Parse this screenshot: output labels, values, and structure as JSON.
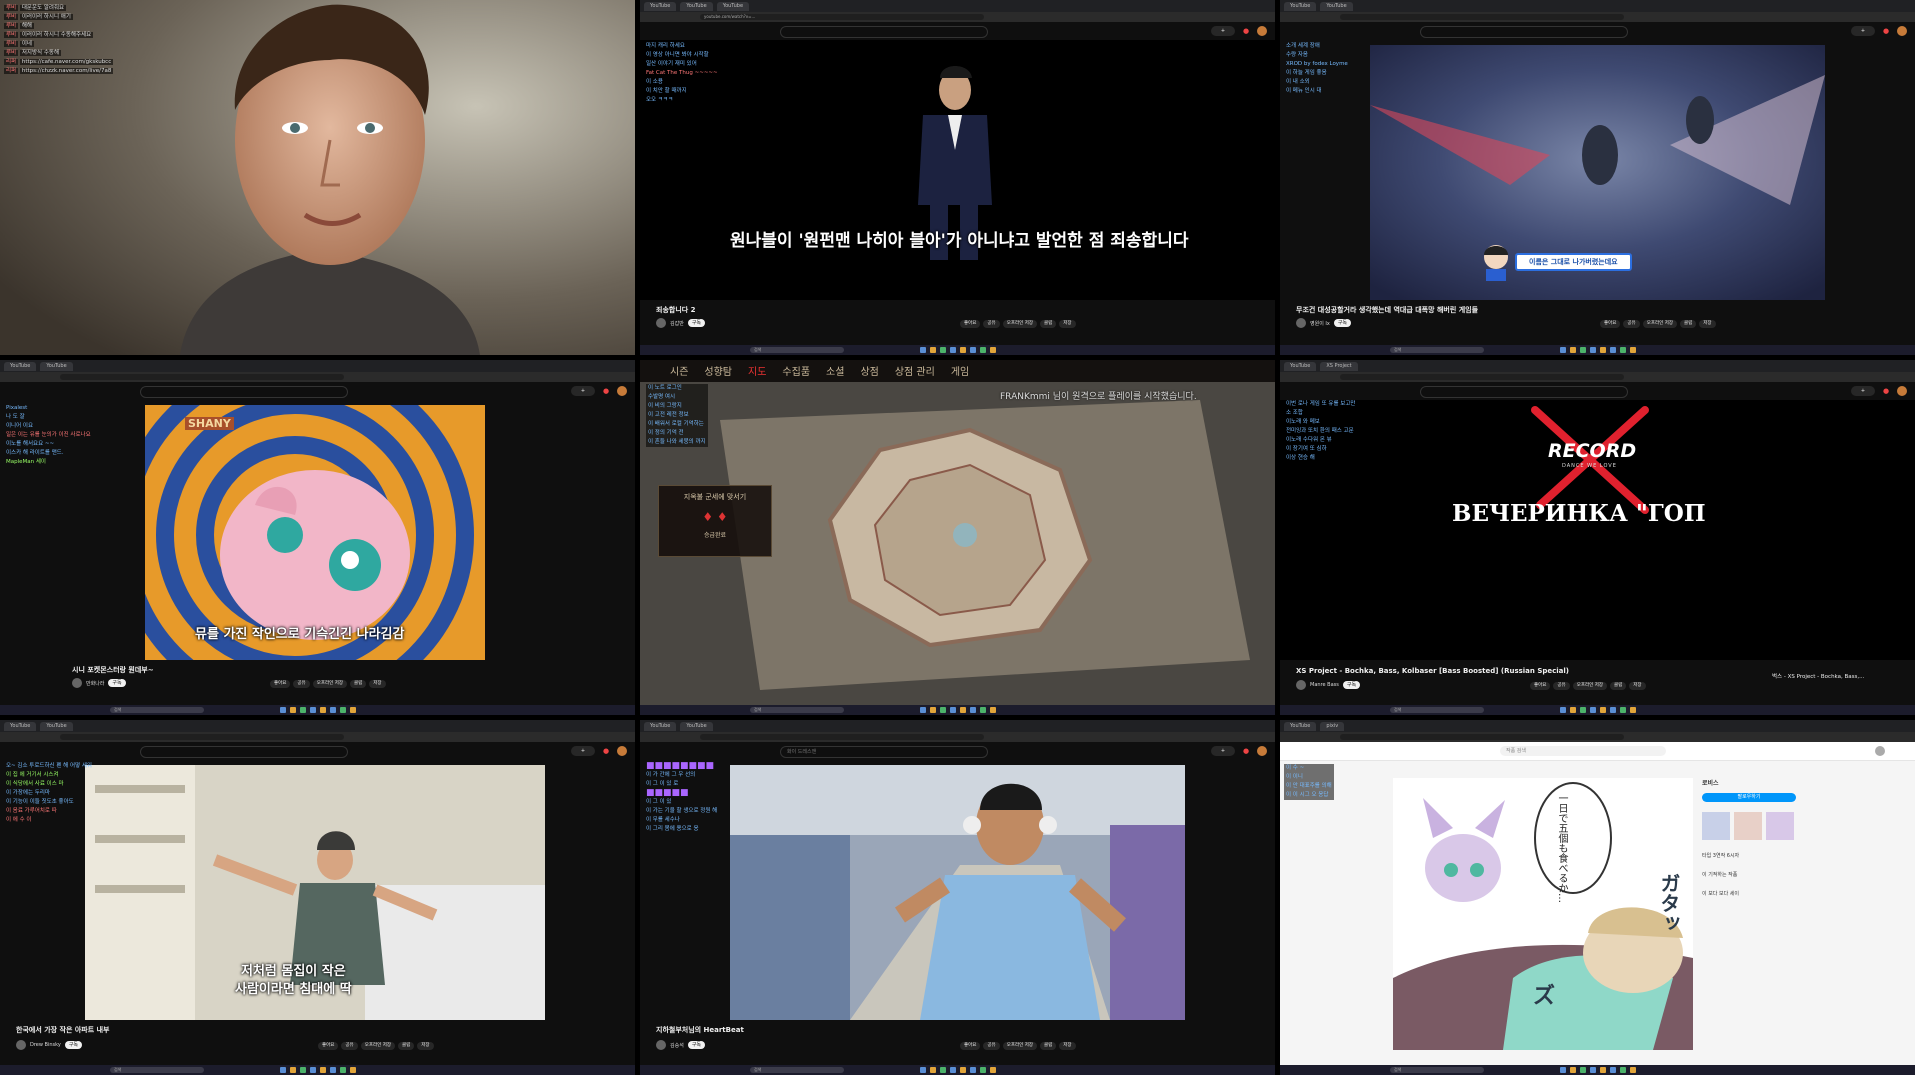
{
  "grid": {
    "tiles": 9
  },
  "tile1": {
    "chat": [
      {
        "name": "루비",
        "text": "대문운도 알려줘요"
      },
      {
        "name": "루비",
        "text": "이러이러 하시니 애기"
      },
      {
        "name": "루비",
        "text": "해해"
      },
      {
        "name": "루비",
        "text": "이러이러 하시니 수동해주세요"
      },
      {
        "name": "루비",
        "text": "이네"
      },
      {
        "name": "루비",
        "text": "저지방식 수동해"
      },
      {
        "name": "리퍼",
        "text": "https://cafe.naver.com/gkskubcc"
      },
      {
        "name": "리퍼",
        "text": "https://chzzk.naver.com/live/7a8"
      }
    ]
  },
  "tile2": {
    "tabs": [
      "YouTube",
      "YouTube",
      "YouTube"
    ],
    "url": "youtube.com/watch?v=...",
    "chat": [
      {
        "name": "",
        "text": "마지 캐리 하세요"
      },
      {
        "name": "",
        "text": "이 영상 아니면 봐야 시작할"
      },
      {
        "name": "",
        "text": "일산 이야기 재미 있어"
      },
      {
        "name": "",
        "text": "Fat Cat The Thug ~~~~~"
      },
      {
        "name": "",
        "text": "이 소용"
      },
      {
        "name": "",
        "text": "이 치안 할 때까지"
      },
      {
        "name": "",
        "text": "오오 ㅋㅋㅋ"
      }
    ],
    "subtitle": "원나블이 '원펀맨 나히아 블아'가 아니냐고 발언한 점 죄송합니다",
    "title": "죄송합니다 2",
    "channel": "김갑반",
    "subscribe": "구독",
    "actions": [
      "좋아요",
      "공유",
      "오프라인 저장",
      "클립",
      "저장"
    ]
  },
  "tile3": {
    "chat": [
      {
        "name": "",
        "text": "소개 세계 장애"
      },
      {
        "name": "",
        "text": "수량 자음"
      },
      {
        "name": "",
        "text": "XROD by fodex Loyme"
      },
      {
        "name": "",
        "text": "이 하늘 게임 좋음"
      },
      {
        "name": "",
        "text": "이 내 소외"
      },
      {
        "name": "",
        "text": "이 메뉴 인시 대"
      }
    ],
    "badge": "이름은 그대로 나가버렸는데요",
    "title": "무조건 대성공할거라 생각했는데 역대급 대폭망 해버린 게임들",
    "channel": "영원이 Ix",
    "subscribe": "구독",
    "actions": [
      "좋아요",
      "공유",
      "오프라인 저장",
      "클립",
      "저장"
    ]
  },
  "tile4": {
    "chat": [
      {
        "name": "",
        "text": "Pixalest"
      },
      {
        "name": "",
        "text": "나 도 잘"
      },
      {
        "name": "",
        "text": "이니어 이요"
      },
      {
        "name": "",
        "text": "일은 이는 유를 눈의가 이진 사로나요"
      },
      {
        "name": "",
        "text": "이노를 해서요요 ~~"
      },
      {
        "name": "",
        "text": "이스카 해 라이트를 맨드."
      },
      {
        "name": "",
        "text": "MapleMan 세이"
      }
    ],
    "logo": "SHANY",
    "subtitle": "뮤를 가진 작인으로 기슥긴긴 나라김감",
    "title": "시니 포켓몬스터랑 뭔데부~",
    "channel": "만화나라",
    "subscribe": "구독",
    "actions": [
      "좋아요",
      "공유",
      "오프라인 저장",
      "클립",
      "저장"
    ]
  },
  "tile5": {
    "menu": [
      "시즌",
      "성향탐",
      "지도",
      "수집품",
      "소셜",
      "상점",
      "상점 관리",
      "게임"
    ],
    "active": "지도",
    "notice": "FRANKmmi 님이 원격으로 플레이를 시작했습니다.",
    "chat": [
      {
        "name": "",
        "text": "이 노트 로그인"
      },
      {
        "name": "",
        "text": "수발명 여시"
      },
      {
        "name": "",
        "text": "이 비의 그랑지"
      },
      {
        "name": "",
        "text": "이 고전 레전 정보"
      },
      {
        "name": "",
        "text": "이 배워서 로컬 기억하는"
      },
      {
        "name": "",
        "text": "이 정의 기억 전"
      },
      {
        "name": "",
        "text": "이 흔들 나와 세뭉의 까지"
      }
    ],
    "panel": "지옥불 군세에 맞서기",
    "panel_sub": "승급완료"
  },
  "tile6": {
    "chat": [
      {
        "name": "",
        "text": "이번 로나 게임 또 유를 보고만"
      },
      {
        "name": "",
        "text": "소 조합"
      },
      {
        "name": "",
        "text": "이노래 와 메보"
      },
      {
        "name": "",
        "text": "전미잉과 또치 환의 패스 고문"
      },
      {
        "name": "",
        "text": "이노래 수다워 몬 뷰"
      },
      {
        "name": "",
        "text": "이 장기여 또 심하"
      },
      {
        "name": "",
        "text": "이상 현승 해"
      }
    ],
    "logo": "RECORD",
    "logo_sub": "DANCE WE LOVE",
    "caption": "ВЕЧЕРИНКА \"ГОП",
    "title": "XS Project - Bochka, Bass, Kolbaser [Bass Boosted] (Russian Special)",
    "channel": "Manre Bass",
    "subscribe": "구독",
    "actions": [
      "좋아요",
      "공유",
      "오프라인 저장",
      "클립",
      "저장"
    ],
    "mini": "벅스 - XS Project - Bochka, Bass,..."
  },
  "tile7": {
    "chat": [
      {
        "name": "",
        "text": "오~ 김소 투로드하신 펜 해 어떻 세워"
      },
      {
        "name": "",
        "text": "이 집 에 거기서 시스켜"
      },
      {
        "name": "",
        "text": "이 식당에서 사료 이스 마"
      },
      {
        "name": "",
        "text": "이 가장에는 두리마"
      },
      {
        "name": "",
        "text": "이 기능이 이들 짓도초 좋아도"
      },
      {
        "name": "",
        "text": "이 음료 가루어치로 따"
      },
      {
        "name": "",
        "text": "이 에 수 이"
      }
    ],
    "subtitle_line1": "저처럼 몸집이 작은",
    "subtitle_line2": "사람이라면 침대에 딱",
    "title": "한국에서 가장 작은 아파트 내부",
    "channel": "Drew Binsky",
    "subscribe": "구독",
    "actions": [
      "좋아요",
      "공유",
      "오프라인 저장",
      "클립",
      "저장"
    ]
  },
  "tile8": {
    "header": "화이 드레스앤",
    "chat": [
      {
        "name": "",
        "text": "이 가 간에 그 우 선의"
      },
      {
        "name": "",
        "text": "이 그 이 있 로"
      },
      {
        "name": "",
        "text": "이 그 이 있"
      },
      {
        "name": "",
        "text": "이 가는 기울 할 생으로 정원 해"
      },
      {
        "name": "",
        "text": "이 무를 세수나"
      },
      {
        "name": "",
        "text": "이 그리 몸에 용으로 응"
      }
    ],
    "title": "지하철부처님의 HeartBeat",
    "channel": "김승석",
    "subscribe": "구독",
    "actions": [
      "좋아요",
      "공유",
      "오프라인 저장",
      "클립",
      "저장"
    ]
  },
  "tile9": {
    "tabs": [
      "YouTube",
      "pixiv"
    ],
    "search": "작품 검색",
    "chat": [
      {
        "name": "",
        "text": "이 수 ~"
      },
      {
        "name": "",
        "text": "이 이니"
      },
      {
        "name": "",
        "text": "이 안 대표주를 의해"
      },
      {
        "name": "",
        "text": "이 이 시그 오 응답"
      }
    ],
    "bubble": "一日で五個も食べるか…",
    "sfx1": "ガタッ",
    "sfx2": "ズ",
    "follow": "팔로우하기",
    "side_name": "로비스",
    "side_items": [
      "타입 3연작 6시자",
      "이 기적하는 작품",
      "이 보다 보다 세이"
    ]
  },
  "colors": {
    "yt_bg": "#0f0f0f",
    "accent": "#ff0000",
    "link": "#3ea6ff"
  },
  "icons": [
    "search-icon",
    "bell-icon",
    "avatar",
    "like-icon",
    "share-icon",
    "mic-icon",
    "create-icon"
  ]
}
